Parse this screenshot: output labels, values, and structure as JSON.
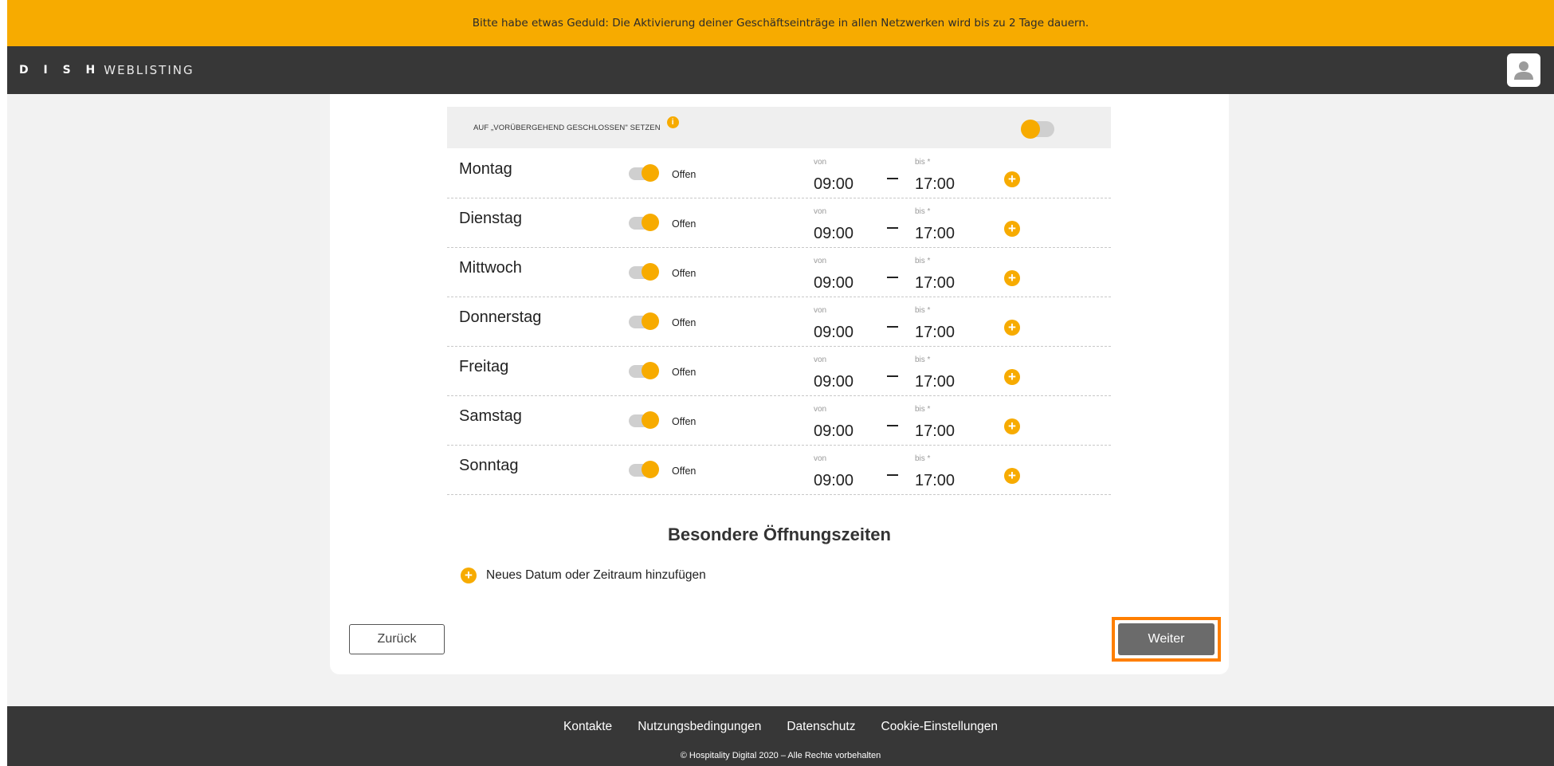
{
  "banner": {
    "text": "Bitte habe etwas Geduld: Die Aktivierung deiner Geschäftseinträge in allen Netzwerken wird bis zu 2 Tage dauern."
  },
  "header": {
    "brand": "D I S H",
    "product": "WEBLISTING"
  },
  "temporary_closed": {
    "label": "AUF „VORÜBERGEHEND GESCHLOSSEN\" SETZEN",
    "info": "i"
  },
  "days": [
    {
      "name": "Montag",
      "status": "Offen",
      "from_label": "von",
      "to_label": "bis *",
      "from": "09:00",
      "to": "17:00"
    },
    {
      "name": "Dienstag",
      "status": "Offen",
      "from_label": "von",
      "to_label": "bis *",
      "from": "09:00",
      "to": "17:00"
    },
    {
      "name": "Mittwoch",
      "status": "Offen",
      "from_label": "von",
      "to_label": "bis *",
      "from": "09:00",
      "to": "17:00"
    },
    {
      "name": "Donnerstag",
      "status": "Offen",
      "from_label": "von",
      "to_label": "bis *",
      "from": "09:00",
      "to": "17:00"
    },
    {
      "name": "Freitag",
      "status": "Offen",
      "from_label": "von",
      "to_label": "bis *",
      "from": "09:00",
      "to": "17:00"
    },
    {
      "name": "Samstag",
      "status": "Offen",
      "from_label": "von",
      "to_label": "bis *",
      "from": "09:00",
      "to": "17:00"
    },
    {
      "name": "Sonntag",
      "status": "Offen",
      "from_label": "von",
      "to_label": "bis *",
      "from": "09:00",
      "to": "17:00"
    }
  ],
  "special": {
    "title": "Besondere Öffnungszeiten",
    "add_label": "Neues Datum oder Zeitraum hinzufügen"
  },
  "buttons": {
    "back": "Zurück",
    "next": "Weiter"
  },
  "footer": {
    "links": [
      "Kontakte",
      "Nutzungsbedingungen",
      "Datenschutz",
      "Cookie-Einstellungen"
    ],
    "copyright": "© Hospitality Digital 2020 – Alle Rechte vorbehalten"
  },
  "colors": {
    "accent": "#f7ab00",
    "dark": "#373737",
    "highlight": "#ff7f00",
    "button_next": "#6b6b6b"
  }
}
